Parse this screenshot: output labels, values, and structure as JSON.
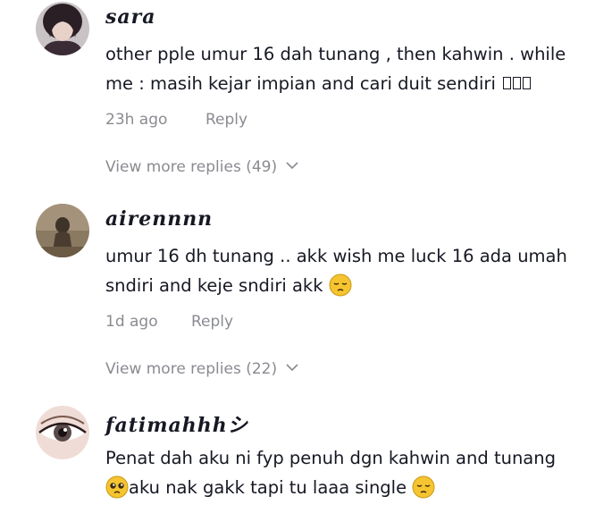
{
  "comments": [
    {
      "username": "sara",
      "text_line1": "other pple umur 16 dah tunang , then kahwin . while",
      "text_line2": "me : masih kejar impian and cari duit sendiri",
      "time": "23h ago",
      "reply_label": "Reply",
      "view_more": "View more replies (49)"
    },
    {
      "username": "airennnn",
      "text_line1": "umur 16 dh tunang .. akk wish me luck 16 ada umah",
      "text_line2": "sndiri and keje sndiri akk",
      "time": "1d ago",
      "reply_label": "Reply",
      "view_more": "View more replies (22)"
    },
    {
      "username": "fatimahhhシ",
      "text_line1": "Penat dah aku ni fyp penuh dgn kahwin and tunang",
      "text_line2": "aku nak gakk tapi tu laaa single"
    }
  ],
  "icons": {
    "chevron": "chevron-down-icon",
    "emoji_pensive": "pensive-face-emoji",
    "emoji_pleading": "pleading-face-emoji"
  },
  "colors": {
    "text": "#161823",
    "muted": "#8a8b91",
    "emoji": "#f5c430"
  }
}
